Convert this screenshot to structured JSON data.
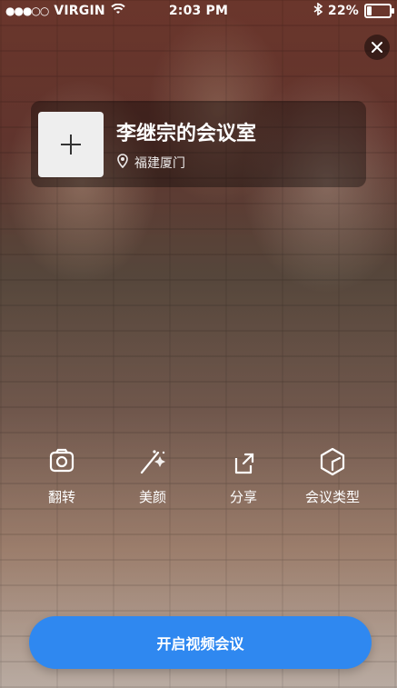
{
  "status_bar": {
    "signal": "●●●○○",
    "carrier": "VIRGIN",
    "time": "2:03 PM",
    "battery_text": "22%",
    "battery_level": 0.22
  },
  "room": {
    "title": "李继宗的会议室",
    "location": "福建厦门"
  },
  "actions": [
    {
      "label": "翻转",
      "icon": "camera-flip-icon"
    },
    {
      "label": "美颜",
      "icon": "beauty-wand-icon"
    },
    {
      "label": "分享",
      "icon": "share-icon"
    },
    {
      "label": "会议类型",
      "icon": "meeting-type-icon"
    }
  ],
  "cta": {
    "label": "开启视频会议"
  },
  "colors": {
    "primary": "#2f88f0"
  }
}
